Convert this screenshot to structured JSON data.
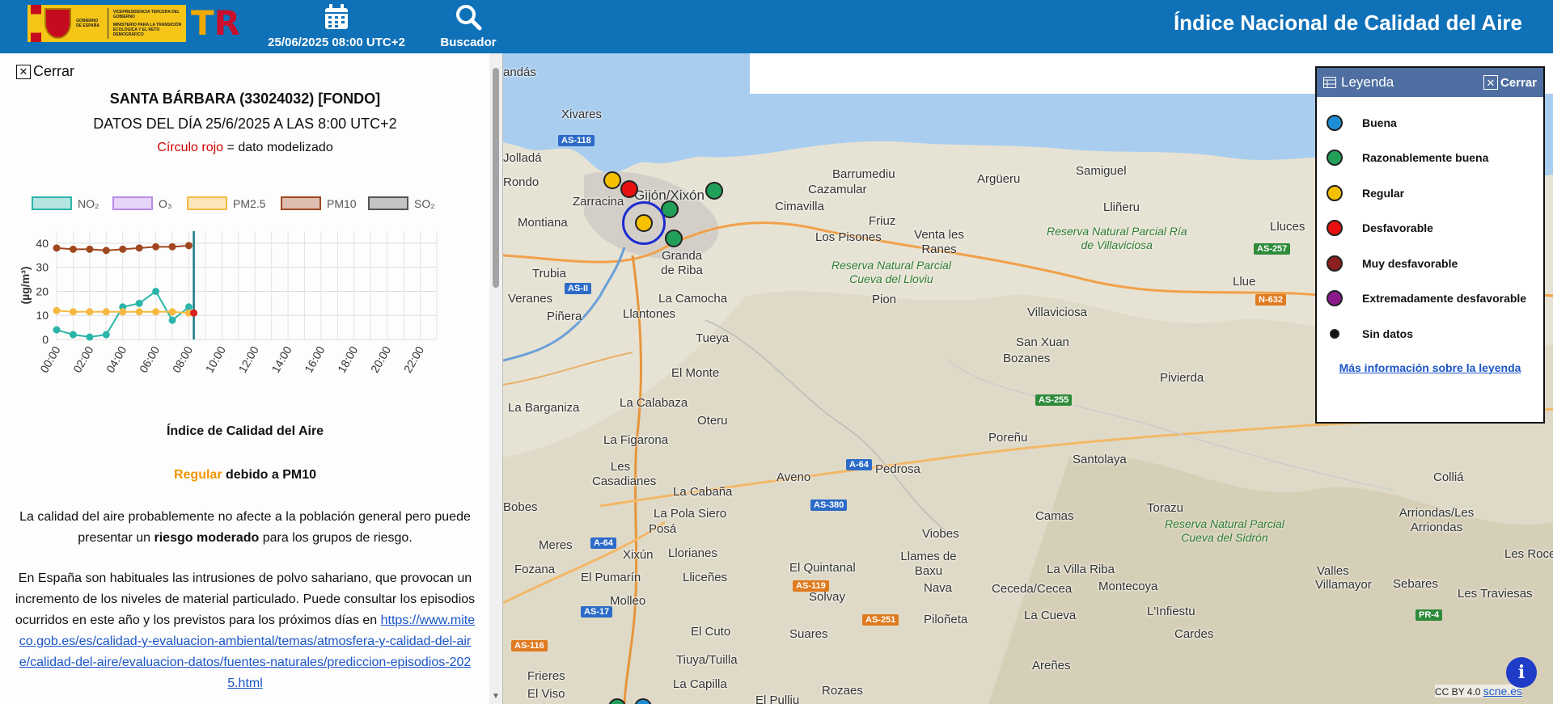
{
  "header": {
    "logo_text_1": "VICEPRESIDENCIA TERCERA DEL GOBIERNO",
    "logo_text_2": "MINISTERIO PARA LA TRANSICIÓN ECOLÓGICA Y EL RETO DEMOGRÁFICO",
    "logo_gov": "GOBIERNO DE ESPAÑA",
    "datetime": "25/06/2025 08:00 UTC+2",
    "search_label": "Buscador",
    "title": "Índice Nacional de Calidad del Aire"
  },
  "panel": {
    "close_label": "Cerrar",
    "station_title": "SANTA BÁRBARA (33024032) [FONDO]",
    "date_line": "DATOS DEL DÍA 25/6/2025 A LAS 8:00 UTC+2",
    "note_red": "Círculo rojo",
    "note_rest": " = dato modelizado",
    "aqi_title": "Índice de Calidad del Aire",
    "aqi_level": "Regular",
    "aqi_reason": " debido a PM10",
    "para1_a": "La calidad del aire probablemente no afecte a la población general pero puede presentar un ",
    "para1_b": "riesgo moderado",
    "para1_c": " para los grupos de riesgo.",
    "para2": "En España son habituales las intrusiones de polvo sahariano, que provocan un incremento de los niveles de material particulado. Puede consultar los episodios ocurridos en este año y los previstos para los próximos días en ",
    "para2_link": "https://www.miteco.gob.es/es/calidad-y-evaluacion-ambiental/temas/atmosfera-y-calidad-del-aire/calidad-del-aire/evaluacion-datos/fuentes-naturales/prediccion-episodios-2025.html"
  },
  "legend": {
    "title": "Leyenda",
    "close_label": "Cerrar",
    "items": [
      {
        "label": "Buena",
        "color": "#1e8fd6"
      },
      {
        "label": "Razonablemente buena",
        "color": "#22a05a"
      },
      {
        "label": "Regular",
        "color": "#f5c000"
      },
      {
        "label": "Desfavorable",
        "color": "#e81010"
      },
      {
        "label": "Muy desfavorable",
        "color": "#8b2020"
      },
      {
        "label": "Extremadamente desfavorable",
        "color": "#8b1a8b"
      },
      {
        "label": "Sin datos",
        "color": "#111111"
      }
    ],
    "more_info": "Más información sobre la leyenda"
  },
  "map": {
    "attribution": "CC BY 4.0",
    "attribution_link": "scne.es",
    "places": [
      "andás",
      "Xivares",
      "Jolladá",
      "Rondo",
      "Zarracina",
      "Montiana",
      "Gijón/Xixón",
      "Barrumediu",
      "Cazamular",
      "Cimavilla",
      "Friuz",
      "Los Pisones",
      "Venta les Ranes",
      "Argüeru",
      "Samiguel",
      "Lliñeru",
      "Lluces",
      "Trubia",
      "Granda de Riba",
      "Veranes",
      "La Camocha",
      "Piñera",
      "Llantones",
      "Pion",
      "Villaviciosa",
      "Llue",
      "Tueya",
      "San Xuan",
      "Bozanes",
      "Pivierda",
      "El Monte",
      "La Barganiza",
      "La Calabaza",
      "Oteru",
      "Poreñu",
      "Santolaya",
      "La Figarona",
      "Pedrosa",
      "Les Casadianes",
      "Aveno",
      "La Cabaña",
      "Colliá",
      "Bobes",
      "La Pola Siero",
      "Camas",
      "Torazu",
      "Arriondas/Les Arriondas",
      "Meres",
      "Posá",
      "Viobes",
      "Xixún",
      "Llorianes",
      "El Quintanal",
      "Llames de Baxu",
      "Valles",
      "Fozana",
      "El Pumarín",
      "Lliceñes",
      "Solvay",
      "La Villa Riba",
      "Villamayor",
      "Sebares",
      "Les Roces",
      "Nava",
      "Ceceda/Cecea",
      "Montecoya",
      "Molleo",
      "Les Traviesas",
      "L'Infiestu",
      "El Cuto",
      "Cardes",
      "Suares",
      "Piloñeta",
      "La Cueva",
      "Tiuya/Tuilla",
      "Areñes",
      "Frieres",
      "El Viso",
      "La Capilla",
      "Rozaes",
      "El Pulliu"
    ],
    "reserves": [
      {
        "l1": "Reserva Natural Parcial",
        "l2": "Cueva del Lloviu"
      },
      {
        "l1": "Reserva Natural Parcial Ría",
        "l2": "de Villaviciosa"
      },
      {
        "l1": "Reserva Natural Parcial",
        "l2": "Cueva del Sidrón"
      }
    ],
    "roads": [
      "AS-118",
      "AS-II",
      "AS-257",
      "N-632",
      "AS-255",
      "A-64",
      "AS-380",
      "A-64",
      "AS-119",
      "AS-251",
      "AS-17",
      "AS-116",
      "PR-4"
    ],
    "station_levels": [
      "Regular",
      "Desfavorable",
      "Razonablemente buena",
      "Razonablemente buena",
      "Regular",
      "Razonablemente buena",
      "Razonablemente buena",
      "Buena"
    ]
  },
  "chart_data": {
    "type": "line",
    "xlabel": "",
    "ylabel": "(µg/m³)",
    "ylim": [
      0,
      45
    ],
    "yticks": [
      0,
      10,
      20,
      30,
      40
    ],
    "categories": [
      "00:00",
      "02:00",
      "04:00",
      "06:00",
      "08:00",
      "10:00",
      "12:00",
      "14:00",
      "16:00",
      "18:00",
      "20:00",
      "22:00"
    ],
    "x_hours": [
      0,
      1,
      2,
      3,
      4,
      5,
      6,
      7,
      8
    ],
    "current_hour": 8.3,
    "series": [
      {
        "name": "NO₂",
        "color": "#2bb5a9",
        "values": [
          4,
          2,
          1,
          2,
          13.5,
          15,
          20,
          8,
          13.5
        ]
      },
      {
        "name": "O₃",
        "color": "#b98ae8",
        "values": []
      },
      {
        "name": "PM2.5",
        "color": "#f5b942",
        "values": [
          12,
          11.5,
          11.5,
          11.5,
          11.5,
          11.5,
          11.5,
          11.5,
          11
        ]
      },
      {
        "name": "PM10",
        "color": "#a0471f",
        "values": [
          38,
          37.5,
          37.5,
          37,
          37.5,
          38,
          38.5,
          38.5,
          39
        ]
      },
      {
        "name": "SO₂",
        "color": "#555555",
        "values": []
      }
    ],
    "legend_position": "top"
  }
}
